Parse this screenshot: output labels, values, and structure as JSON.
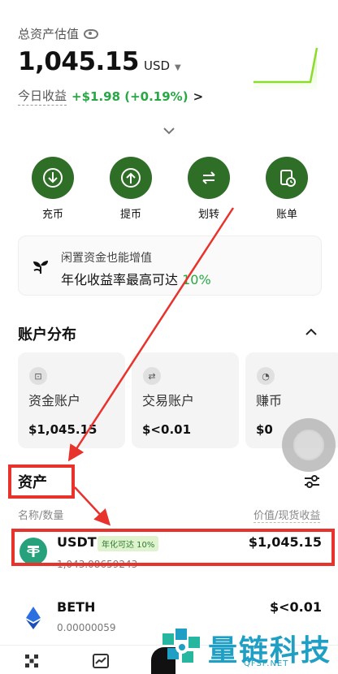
{
  "header": {
    "total_label": "总资产估值",
    "balance": "1,045.15",
    "currency": "USD",
    "today_label": "今日收益",
    "today_value": "+$1.98 (+0.19%)",
    "today_arrow": ">"
  },
  "actions": [
    {
      "label": "充币",
      "icon": "deposit-icon"
    },
    {
      "label": "提币",
      "icon": "withdraw-icon"
    },
    {
      "label": "划转",
      "icon": "transfer-icon"
    },
    {
      "label": "账单",
      "icon": "bill-icon"
    }
  ],
  "promo": {
    "title": "闲置资金也能增值",
    "subtitle": "年化收益率最高可达 ",
    "rate": "10%"
  },
  "distribution": {
    "title": "账户分布",
    "accounts": [
      {
        "name": "资金账户",
        "value": "$1,045.15"
      },
      {
        "name": "交易账户",
        "value": "$<0.01"
      },
      {
        "name": "赚币",
        "value": "$0"
      }
    ]
  },
  "assets": {
    "title": "资产",
    "col_left": "名称/数量",
    "col_right": "价值/现货收益",
    "rows": [
      {
        "symbol": "USDT",
        "tag": "年化可达 10%",
        "amount": "1,043.08659243",
        "value": "$1,045.15",
        "pnl": "--"
      },
      {
        "symbol": "BETH",
        "tag": "",
        "amount": "0.00000059",
        "value": "$<0.01",
        "pnl": ""
      }
    ]
  },
  "watermark": {
    "text": "量链科技",
    "sub": "QFSP.NET"
  },
  "colors": {
    "brand_green": "#2e6e26",
    "profit_green": "#27a844",
    "annotation_red": "#e8322c"
  }
}
